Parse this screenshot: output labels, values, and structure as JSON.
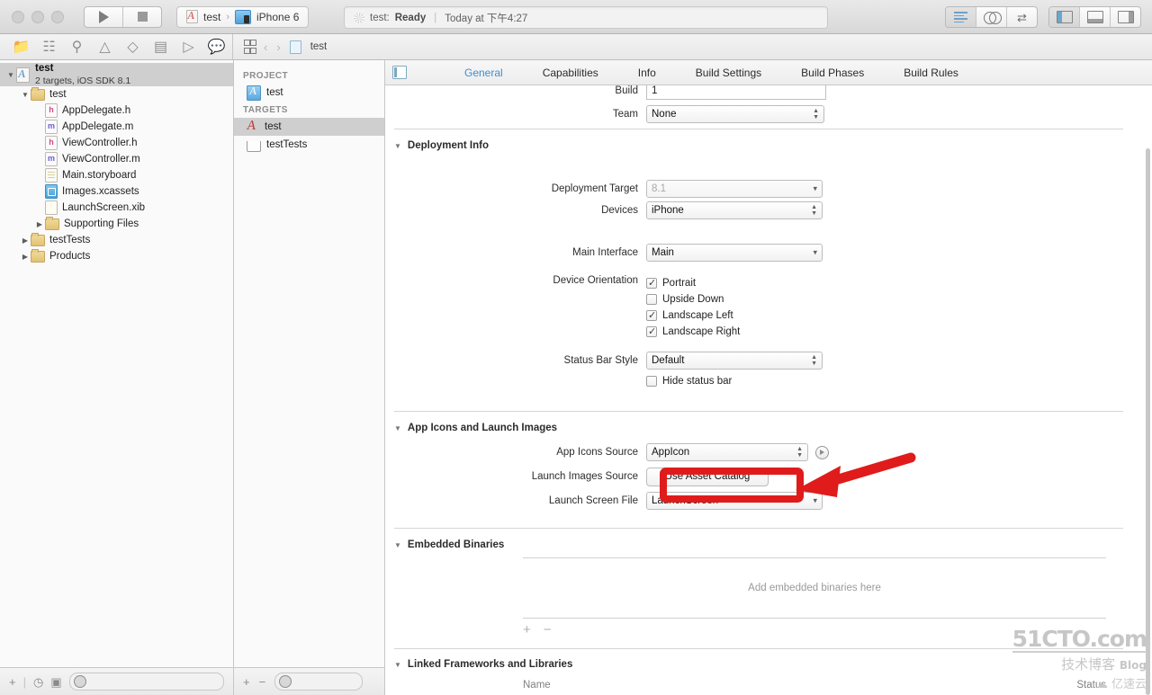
{
  "titlebar": {
    "run_icon": "play-icon",
    "stop_icon": "stop-icon",
    "scheme_name": "test",
    "scheme_separator": "›",
    "destination": "iPhone 6",
    "status_prefix": "test: ",
    "status_state": "Ready",
    "status_pipe": "|",
    "status_time": "Today at 下午4:27"
  },
  "jumpbar": {
    "document": "test"
  },
  "navigator": {
    "project": {
      "name": "test",
      "subtitle": "2 targets, iOS SDK 8.1"
    },
    "items": [
      {
        "label": "test",
        "kind": "folder",
        "depth": 1,
        "disclosure": "open"
      },
      {
        "label": "AppDelegate.h",
        "kind": "h",
        "depth": 2,
        "disclosure": "none"
      },
      {
        "label": "AppDelegate.m",
        "kind": "m",
        "depth": 2,
        "disclosure": "none"
      },
      {
        "label": "ViewController.h",
        "kind": "h",
        "depth": 2,
        "disclosure": "none"
      },
      {
        "label": "ViewController.m",
        "kind": "m",
        "depth": 2,
        "disclosure": "none"
      },
      {
        "label": "Main.storyboard",
        "kind": "sb",
        "depth": 2,
        "disclosure": "none"
      },
      {
        "label": "Images.xcassets",
        "kind": "assets",
        "depth": 2,
        "disclosure": "none"
      },
      {
        "label": "LaunchScreen.xib",
        "kind": "xib",
        "depth": 2,
        "disclosure": "none"
      },
      {
        "label": "Supporting Files",
        "kind": "folder",
        "depth": 2,
        "disclosure": "closed"
      },
      {
        "label": "testTests",
        "kind": "folder",
        "depth": 1,
        "disclosure": "closed"
      },
      {
        "label": "Products",
        "kind": "folder",
        "depth": 1,
        "disclosure": "closed"
      }
    ]
  },
  "project_pane": {
    "project_header": "PROJECT",
    "project_item": "test",
    "targets_header": "TARGETS",
    "targets": [
      {
        "label": "test",
        "kind": "app",
        "selected": true
      },
      {
        "label": "testTests",
        "kind": "test",
        "selected": false
      }
    ]
  },
  "tabs": [
    {
      "label": "General",
      "active": true
    },
    {
      "label": "Capabilities",
      "active": false
    },
    {
      "label": "Info",
      "active": false
    },
    {
      "label": "Build Settings",
      "active": false
    },
    {
      "label": "Build Phases",
      "active": false
    },
    {
      "label": "Build Rules",
      "active": false
    }
  ],
  "identity": {
    "build_label": "Build",
    "build_value": "1",
    "team_label": "Team",
    "team_value": "None"
  },
  "deployment_info": {
    "section_title": "Deployment Info",
    "deployment_target_label": "Deployment Target",
    "deployment_target_value": "8.1",
    "devices_label": "Devices",
    "devices_value": "iPhone",
    "main_interface_label": "Main Interface",
    "main_interface_value": "Main",
    "device_orientation_label": "Device Orientation",
    "orientations": [
      {
        "label": "Portrait",
        "checked": true
      },
      {
        "label": "Upside Down",
        "checked": false
      },
      {
        "label": "Landscape Left",
        "checked": true
      },
      {
        "label": "Landscape Right",
        "checked": true
      }
    ],
    "status_bar_style_label": "Status Bar Style",
    "status_bar_style_value": "Default",
    "hide_status_bar_label": "Hide status bar",
    "hide_status_bar_checked": false
  },
  "app_icons": {
    "section_title": "App Icons and Launch Images",
    "app_icons_source_label": "App Icons Source",
    "app_icons_source_value": "AppIcon",
    "launch_images_source_label": "Launch Images Source",
    "launch_images_source_button": "Use Asset Catalog",
    "launch_screen_file_label": "Launch Screen File",
    "launch_screen_file_value": "LaunchScreen"
  },
  "embedded_binaries": {
    "section_title": "Embedded Binaries",
    "empty_text": "Add embedded binaries here",
    "add_label": "+",
    "remove_label": "−"
  },
  "linked_frameworks": {
    "section_title": "Linked Frameworks and Libraries",
    "col_name": "Name",
    "col_status": "Status"
  },
  "annotation": {
    "color": "#e01b1b",
    "target": "Use Asset Catalog"
  },
  "watermark": {
    "line1": "51CTO.com",
    "line2": "技术博客",
    "line2_suffix": "Blog",
    "line3": "亿速云"
  }
}
